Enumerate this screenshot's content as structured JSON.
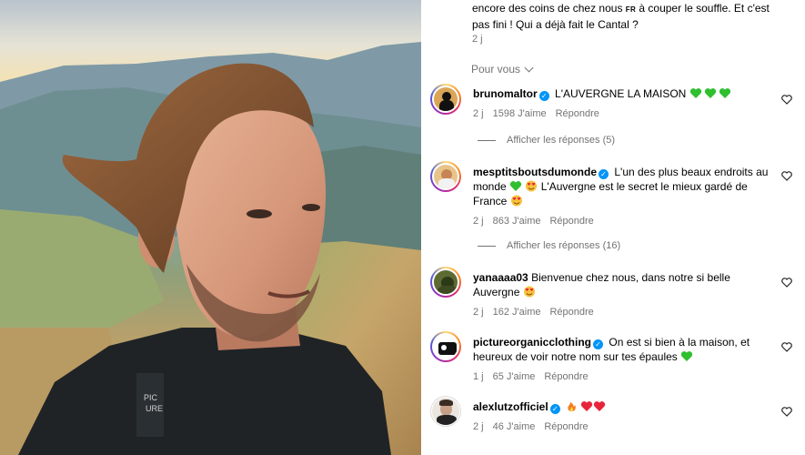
{
  "caption": {
    "text_before": "encore des coins de chez nous",
    "flag": "FR",
    "text_after": "à couper le souffle. Et c'est pas fini ! Qui a déjà fait le Cantal ?",
    "time": "2 j"
  },
  "sort_label": "Pour vous",
  "comments": [
    {
      "user": "brunomaltor",
      "verified": true,
      "text": "L'AUVERGNE LA MAISON",
      "emojis": [
        "green-heart",
        "green-heart",
        "green-heart"
      ],
      "time": "2 j",
      "likes": "1598 J'aime",
      "reply": "Répondre",
      "view_replies": "Afficher les réponses (5)"
    },
    {
      "user": "mesptitsboutsdumonde",
      "verified": true,
      "text": "L'un des plus beaux endroits au monde",
      "text2": "L'Auvergne est le secret le mieux gardé de France",
      "time": "2 j",
      "likes": "863 J'aime",
      "reply": "Répondre",
      "view_replies": "Afficher les réponses (16)"
    },
    {
      "user": "yanaaaa03",
      "verified": false,
      "text": "Bienvenue chez nous, dans notre si belle Auvergne",
      "time": "2 j",
      "likes": "162 J'aime",
      "reply": "Répondre"
    },
    {
      "user": "pictureorganicclothing",
      "verified": true,
      "text": "On est si bien à la maison, et heureux de voir notre nom sur tes épaules",
      "time": "1 j",
      "likes": "65 J'aime",
      "reply": "Répondre"
    },
    {
      "user": "alexlutzofficiel",
      "verified": true,
      "text": "",
      "time": "2 j",
      "likes": "46 J'aime",
      "reply": "Répondre"
    }
  ],
  "colors": {
    "green_heart": "#2fbf2f",
    "red_heart": "#e8243c",
    "verified": "#0095f6",
    "meta": "#737373"
  },
  "icons": [
    "heart-outline-icon",
    "verified-badge-icon",
    "chevron-down-icon"
  ]
}
